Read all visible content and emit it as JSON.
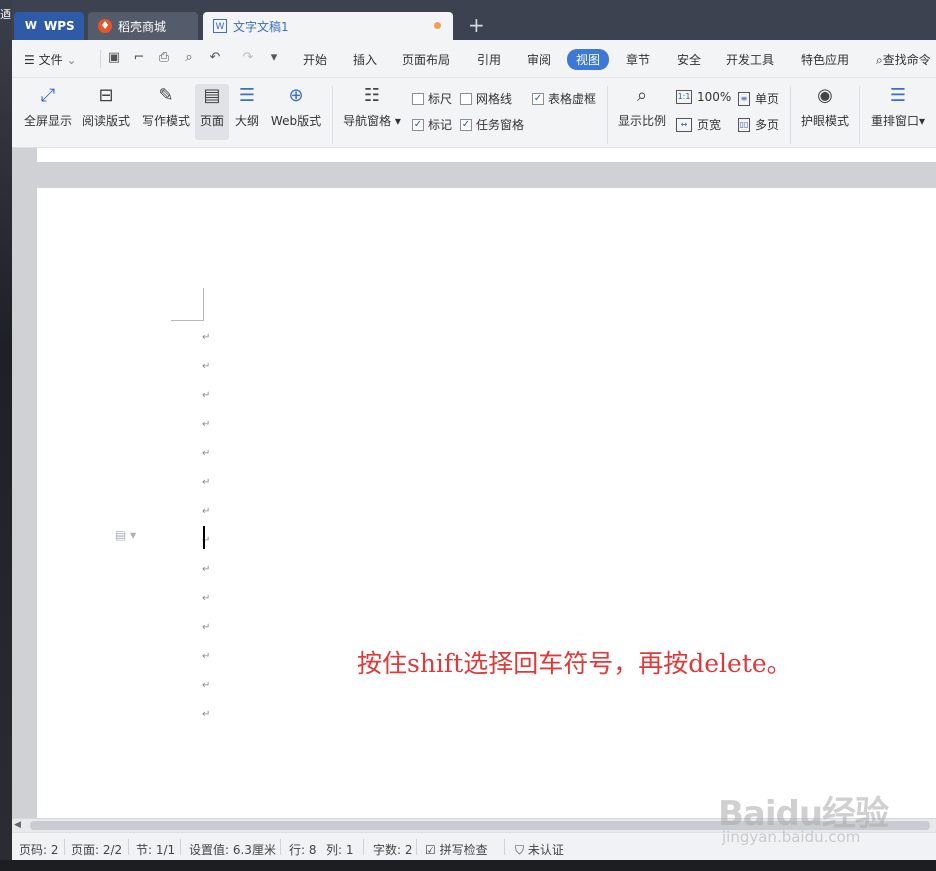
{
  "desktop": {
    "left_text": "迺"
  },
  "tabs": [
    {
      "label": "WPS",
      "icon": "wps-logo-icon"
    },
    {
      "label": "稻壳商城",
      "icon": "flame-icon"
    },
    {
      "label": "文字文稿1",
      "icon": "word-doc-icon",
      "unsaved": true
    }
  ],
  "new_tab_label": "+",
  "menubar": {
    "file_label": "文件",
    "items": [
      "开始",
      "插入",
      "页面布局",
      "引用",
      "审阅",
      "视图",
      "章节",
      "安全",
      "开发工具",
      "特色应用"
    ],
    "active": "视图",
    "search_label": "查找命令"
  },
  "ribbon": {
    "fullscreen": "全屏显示",
    "reading": "阅读版式",
    "writing": "写作模式",
    "page": "页面",
    "outline": "大纲",
    "web": "Web版式",
    "nav_pane": "导航窗格",
    "ruler": "标尺",
    "gridlines": "网格线",
    "table_gridlines": "表格虚框",
    "marks": "标记",
    "task_pane": "任务窗格",
    "zoom": "显示比例",
    "zoom_100": "100%",
    "page_width": "页宽",
    "single_page": "单页",
    "multi_page": "多页",
    "eye_mode": "护眼模式",
    "arrange": "重排窗口",
    "checked": {
      "ruler": false,
      "gridlines": false,
      "table_gridlines": true,
      "marks": true,
      "task_pane": true
    }
  },
  "document": {
    "paragraph_mark": "↵",
    "paragraph_count": 14,
    "annotation": "按住shift选择回车符号，再按delete。",
    "annotation_color": "#e0393a"
  },
  "status": {
    "page_no": "页码: 2",
    "pages": "页面: 2/2",
    "section": "节: 1/1",
    "setting": "设置值: 6.3厘米",
    "row": "行: 8",
    "col": "列: 1",
    "words": "字数: 2",
    "spell": "拼写检查",
    "cert": "未认证"
  },
  "watermark": {
    "brand": "Baidu经验",
    "url": "jingyan.baidu.com"
  }
}
